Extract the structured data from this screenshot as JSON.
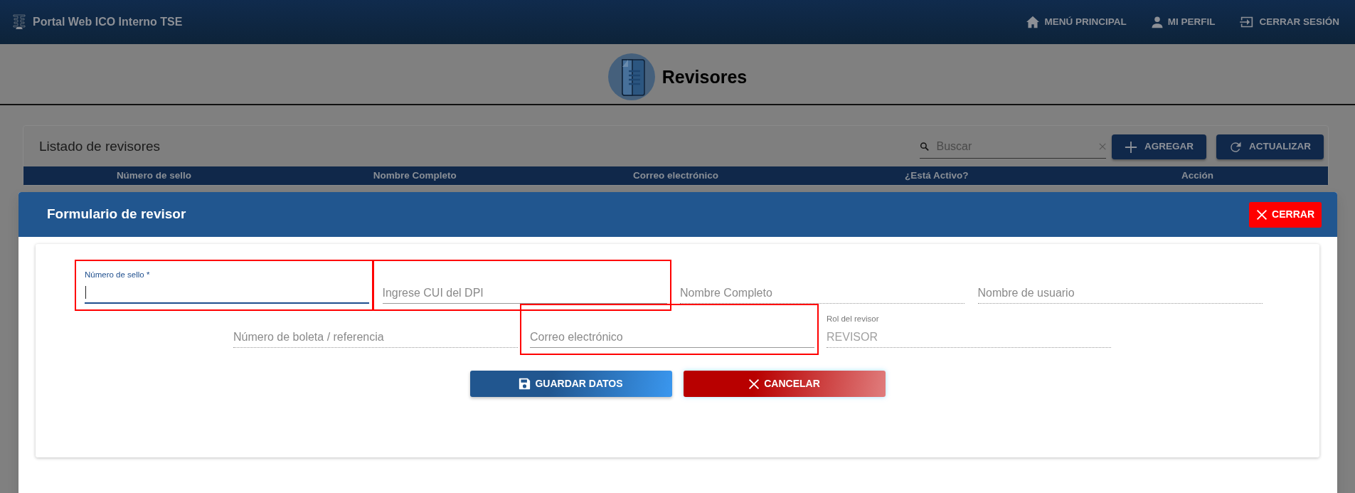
{
  "navbar": {
    "brand": "Portal Web ICO Interno TSE",
    "links": [
      {
        "kind": "home",
        "label": "MENÚ PRINCIPAL"
      },
      {
        "kind": "profile",
        "label": "MI PERFIL"
      },
      {
        "kind": "logout",
        "label": "CERRAR SESIÓN"
      }
    ]
  },
  "page_title": "Revisores",
  "list": {
    "title": "Listado de revisores",
    "search": {
      "placeholder": "Buscar"
    },
    "buttons": [
      {
        "kind": "add",
        "label": "AGREGAR"
      },
      {
        "kind": "refresh",
        "label": "ACTUALIZAR"
      }
    ],
    "columns": [
      "Número de sello",
      "Nombre Completo",
      "Correo electrónico",
      "¿Está Activo?",
      "Acción"
    ]
  },
  "dialog": {
    "title": "Formulario de revisor",
    "close_button": "CERRAR",
    "field_rows": [
      [
        {
          "label": "Número de sello *",
          "focused": true,
          "highlighted": true
        },
        {
          "placeholder": "Ingrese CUI del DPI",
          "focused": false,
          "highlighted": true
        },
        {
          "placeholder": "Nombre Completo",
          "focused": false,
          "highlighted": false
        },
        {
          "placeholder": "Nombre de usuario",
          "focused": false,
          "highlighted": false
        }
      ],
      [
        {
          "placeholder": "Número de boleta / referencia",
          "focused": false,
          "highlighted": false
        },
        {
          "placeholder": "Correo electrónico",
          "focused": false,
          "highlighted": true
        },
        {
          "label": "Rol del revisor",
          "value": "REVISOR",
          "focused": false,
          "highlighted": false,
          "disabled": true
        }
      ]
    ],
    "actions": [
      {
        "kind": "save",
        "label": "GUARDAR DATOS"
      },
      {
        "kind": "cancel",
        "label": "CANCELAR"
      }
    ]
  }
}
